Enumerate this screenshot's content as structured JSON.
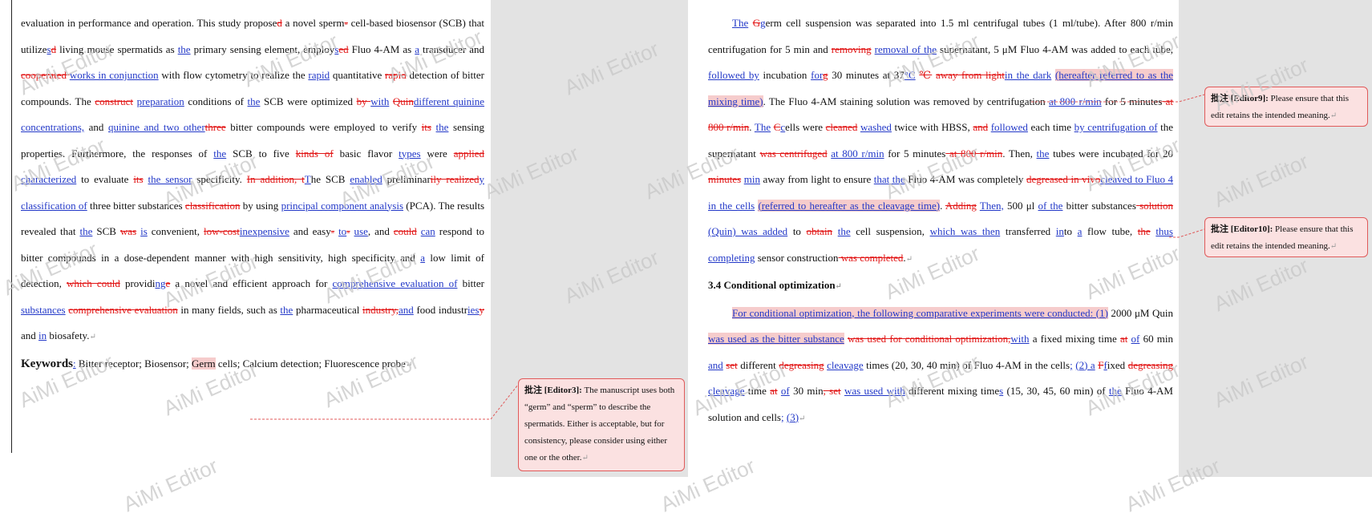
{
  "left_page": {
    "paragraphs": [
      {
        "segs": [
          {
            "t": "evaluation in performance and operation. This study propose"
          },
          {
            "t": "d",
            "s": "del"
          },
          {
            "t": " a novel sperm"
          },
          {
            "t": "-",
            "s": "del"
          },
          {
            "t": " cell-based biosensor (SCB) that utilize"
          },
          {
            "t": "s",
            "s": "ins"
          },
          {
            "t": "d",
            "s": "del"
          },
          {
            "t": " living mouse spermatids as "
          },
          {
            "t": "the",
            "s": "ins"
          },
          {
            "t": " primary sensing element, employ"
          },
          {
            "t": "s",
            "s": "ins"
          },
          {
            "t": "ed",
            "s": "del"
          },
          {
            "t": " Fluo 4-AM as "
          },
          {
            "t": "a",
            "s": "ins"
          },
          {
            "t": " transducer and "
          },
          {
            "t": "cooperated ",
            "s": "del"
          },
          {
            "t": "works in conjunction",
            "s": "ins"
          },
          {
            "t": " with flow cytometry to realize the "
          },
          {
            "t": "rapid",
            "s": "ins"
          },
          {
            "t": " quantitative "
          },
          {
            "t": "rapid",
            "s": "del"
          },
          {
            "t": " detection of bitter compounds. The "
          },
          {
            "t": "construct",
            "s": "del"
          },
          {
            "t": " "
          },
          {
            "t": "preparation",
            "s": "ins"
          },
          {
            "t": " conditions of "
          },
          {
            "t": "the",
            "s": "ins"
          },
          {
            "t": " SCB were optimized "
          },
          {
            "t": "by ",
            "s": "del"
          },
          {
            "t": "with",
            "s": "ins"
          },
          {
            "t": " "
          },
          {
            "t": "Quin",
            "s": "del"
          },
          {
            "t": "different quinine concentrations,",
            "s": "ins"
          },
          {
            "t": " and "
          },
          {
            "t": "quinine and two other",
            "s": "ins"
          },
          {
            "t": "three",
            "s": "del"
          },
          {
            "t": " bitter compounds were employed to verify "
          },
          {
            "t": "its",
            "s": "del"
          },
          {
            "t": " "
          },
          {
            "t": "the",
            "s": "ins"
          },
          {
            "t": " sensing properties. Furthermore, the responses of "
          },
          {
            "t": "the",
            "s": "ins"
          },
          {
            "t": " SCB to five "
          },
          {
            "t": "kinds of",
            "s": "del"
          },
          {
            "t": " basic flavor "
          },
          {
            "t": "types",
            "s": "ins"
          },
          {
            "t": " were "
          },
          {
            "t": "applied",
            "s": "del"
          },
          {
            "t": " "
          },
          {
            "t": "characterized",
            "s": "ins"
          },
          {
            "t": " to evaluate "
          },
          {
            "t": "its",
            "s": "del"
          },
          {
            "t": " "
          },
          {
            "t": "the sensor",
            "s": "ins"
          },
          {
            "t": " specificity. "
          },
          {
            "t": "In addition, t",
            "s": "del"
          },
          {
            "t": "T",
            "s": "ins"
          },
          {
            "t": "he SCB "
          },
          {
            "t": "enabled",
            "s": "ins"
          },
          {
            "t": " preliminar"
          },
          {
            "t": "ily realized",
            "s": "del"
          },
          {
            "t": "y",
            "s": "ins"
          },
          {
            "t": " "
          },
          {
            "t": "classification of",
            "s": "ins"
          },
          {
            "t": " three bitter substances "
          },
          {
            "t": "classification",
            "s": "del"
          },
          {
            "t": " by using "
          },
          {
            "t": "principal component analysis",
            "s": "ins"
          },
          {
            "t": " (PCA). The results revealed that "
          },
          {
            "t": "the",
            "s": "ins"
          },
          {
            "t": " SCB "
          },
          {
            "t": "was",
            "s": "del"
          },
          {
            "t": " "
          },
          {
            "t": "is",
            "s": "ins"
          },
          {
            "t": " convenient, "
          },
          {
            "t": "low-cost",
            "s": "del"
          },
          {
            "t": "inexpensive",
            "s": "ins"
          },
          {
            "t": " and easy"
          },
          {
            "t": "-",
            "s": "del"
          },
          {
            "t": " "
          },
          {
            "t": "to",
            "s": "ins"
          },
          {
            "t": "-",
            "s": "del"
          },
          {
            "t": " "
          },
          {
            "t": "use",
            "s": "ins"
          },
          {
            "t": ", and "
          },
          {
            "t": "could",
            "s": "del"
          },
          {
            "t": " "
          },
          {
            "t": "can",
            "s": "ins"
          },
          {
            "t": " respond to bitter compounds in a dose-dependent manner with high sensitivity, high specificity and "
          },
          {
            "t": "a",
            "s": "ins"
          },
          {
            "t": " low limit of detection, "
          },
          {
            "t": "which could",
            "s": "del"
          },
          {
            "t": " providi"
          },
          {
            "t": "ng",
            "s": "ins"
          },
          {
            "t": "e",
            "s": "del"
          },
          {
            "t": " a novel and efficient approach for "
          },
          {
            "t": "comprehensive evaluation of",
            "s": "ins"
          },
          {
            "t": " bitter "
          },
          {
            "t": "substances",
            "s": "ins"
          },
          {
            "t": " "
          },
          {
            "t": "comprehensive evaluation",
            "s": "del"
          },
          {
            "t": " in many fields, such as "
          },
          {
            "t": "the",
            "s": "ins"
          },
          {
            "t": " pharmaceutical "
          },
          {
            "t": "industry,",
            "s": "del"
          },
          {
            "t": "and",
            "s": "ins"
          },
          {
            "t": " food industr"
          },
          {
            "t": "ies",
            "s": "ins"
          },
          {
            "t": "y",
            "s": "del"
          },
          {
            "t": " and "
          },
          {
            "t": "in",
            "s": "ins"
          },
          {
            "t": " biosafety."
          }
        ]
      },
      {
        "keywords": true,
        "segs": [
          {
            "t": "Keywords",
            "s": "kwlabel"
          },
          {
            "t": ":",
            "s": "ins"
          },
          {
            "t": " Bitter receptor; Biosensor; "
          },
          {
            "t": "Germ",
            "s": "hl"
          },
          {
            "t": " cells; Calcium detection; Fluorescence probe"
          }
        ]
      }
    ]
  },
  "right_page": {
    "paragraphs": [
      {
        "indent": true,
        "segs": [
          {
            "t": "The",
            "s": "ins"
          },
          {
            "t": " "
          },
          {
            "t": "G",
            "s": "del"
          },
          {
            "t": "g",
            "s": "ins"
          },
          {
            "t": "erm cell suspension was separated into 1.5 ml centrifugal tubes (1 ml/tube). After 800 r/min centrifugation for 5 min and "
          },
          {
            "t": "removing",
            "s": "del"
          },
          {
            "t": " "
          },
          {
            "t": "removal of the",
            "s": "ins"
          },
          {
            "t": " supernatant, 5 μM Fluo 4-AM was added to each tube, "
          },
          {
            "t": "followed by",
            "s": "ins"
          },
          {
            "t": " incubation "
          },
          {
            "t": "for",
            "s": "ins"
          },
          {
            "t": "g",
            "s": "del"
          },
          {
            "t": " 30 minutes at 37"
          },
          {
            "t": "°C",
            "s": "ins"
          },
          {
            "t": " "
          },
          {
            "t": "℃",
            "s": "del"
          },
          {
            "t": " "
          },
          {
            "t": "away from light",
            "s": "del"
          },
          {
            "t": "in the dark",
            "s": "ins"
          },
          {
            "t": " "
          },
          {
            "t": "(hereafter referred to as the mixing time)",
            "s": "inshl"
          },
          {
            "t": ". The Fluo 4-AM staining solution was removed by centrifugation "
          },
          {
            "t": "at 800 r/min",
            "s": "ins"
          },
          {
            "t": " for 5 minutes"
          },
          {
            "t": " at 800 r/min",
            "s": "del"
          },
          {
            "t": ". "
          },
          {
            "t": "The",
            "s": "ins"
          },
          {
            "t": " "
          },
          {
            "t": "C",
            "s": "del"
          },
          {
            "t": "c",
            "s": "ins"
          },
          {
            "t": "ells were "
          },
          {
            "t": "cleaned",
            "s": "del"
          },
          {
            "t": " "
          },
          {
            "t": "washed",
            "s": "ins"
          },
          {
            "t": " twice with HBSS, "
          },
          {
            "t": "and",
            "s": "del"
          },
          {
            "t": " "
          },
          {
            "t": "followed",
            "s": "ins"
          },
          {
            "t": " each time "
          },
          {
            "t": "by centrifugation of",
            "s": "ins"
          },
          {
            "t": " the supernatant "
          },
          {
            "t": "was centrifuged",
            "s": "del"
          },
          {
            "t": " "
          },
          {
            "t": "at 800 r/min",
            "s": "ins"
          },
          {
            "t": " for 5 minutes"
          },
          {
            "t": " at 800 r/min",
            "s": "del"
          },
          {
            "t": ". Then, "
          },
          {
            "t": "the",
            "s": "ins"
          },
          {
            "t": " tubes were incubated for 20 "
          },
          {
            "t": "minutes",
            "s": "del"
          },
          {
            "t": " "
          },
          {
            "t": "min",
            "s": "ins"
          },
          {
            "t": " away from light to ensure "
          },
          {
            "t": "that the",
            "s": "ins"
          },
          {
            "t": " Fluo 4-AM was completely "
          },
          {
            "t": "degreased in vivo",
            "s": "del"
          },
          {
            "t": "cleaved to Fluo 4 in the cells",
            "s": "ins"
          },
          {
            "t": " "
          },
          {
            "t": "(referred to hereafter as the cleavage time)",
            "s": "inshl"
          },
          {
            "t": ". "
          },
          {
            "t": "Adding",
            "s": "del"
          },
          {
            "t": " "
          },
          {
            "t": "Then,",
            "s": "ins"
          },
          {
            "t": " 500 μl "
          },
          {
            "t": "of the",
            "s": "ins"
          },
          {
            "t": " bitter substances"
          },
          {
            "t": " solution",
            "s": "del"
          },
          {
            "t": " "
          },
          {
            "t": "(Quin) was added",
            "s": "ins"
          },
          {
            "t": " to "
          },
          {
            "t": "obtain",
            "s": "del"
          },
          {
            "t": " "
          },
          {
            "t": "the",
            "s": "ins"
          },
          {
            "t": " cell suspension, "
          },
          {
            "t": "which was then",
            "s": "ins"
          },
          {
            "t": " transferred "
          },
          {
            "t": "in",
            "s": "ins"
          },
          {
            "t": "to "
          },
          {
            "t": "a",
            "s": "ins"
          },
          {
            "t": " flow tube, "
          },
          {
            "t": "the",
            "s": "del"
          },
          {
            "t": " "
          },
          {
            "t": "thus completing",
            "s": "ins"
          },
          {
            "t": " sensor construction"
          },
          {
            "t": " was completed",
            "s": "del"
          },
          {
            "t": "."
          }
        ]
      },
      {
        "heading": true,
        "segs": [
          {
            "t": "3.4 Conditional optimization"
          }
        ]
      },
      {
        "indent": true,
        "segs": [
          {
            "t": "For conditional optimization, the following comparative experiments were conducted: (1)",
            "s": "inshl"
          },
          {
            "t": " 2000 μM Quin "
          },
          {
            "t": "was used as the bitter substance",
            "s": "inshl"
          },
          {
            "t": " "
          },
          {
            "t": "was used for conditional optimization,",
            "s": "del"
          },
          {
            "t": "with",
            "s": "ins"
          },
          {
            "t": " a fixed mixing time "
          },
          {
            "t": "at",
            "s": "del"
          },
          {
            "t": " "
          },
          {
            "t": "of",
            "s": "ins"
          },
          {
            "t": " 60 min"
          },
          {
            "t": " and",
            "s": "ins"
          },
          {
            "t": " "
          },
          {
            "t": "set",
            "s": "del"
          },
          {
            "t": " different "
          },
          {
            "t": "degreasing",
            "s": "del"
          },
          {
            "t": " "
          },
          {
            "t": "cleavage",
            "s": "ins"
          },
          {
            "t": " times (20, 30, 40 min) of Fluo 4-AM in the cells"
          },
          {
            "t": ";",
            "s": "ins"
          },
          {
            "t": " "
          },
          {
            "t": "(2) a",
            "s": "ins"
          },
          {
            "t": " "
          },
          {
            "t": "F",
            "s": "del"
          },
          {
            "t": "f",
            "s": "ins"
          },
          {
            "t": "ixed "
          },
          {
            "t": "degreasing",
            "s": "del"
          },
          {
            "t": " "
          },
          {
            "t": "cleavage",
            "s": "ins"
          },
          {
            "t": " time "
          },
          {
            "t": "at",
            "s": "del"
          },
          {
            "t": " "
          },
          {
            "t": "of",
            "s": "ins"
          },
          {
            "t": " 30 min"
          },
          {
            "t": ", set",
            "s": "del"
          },
          {
            "t": " "
          },
          {
            "t": "was used with",
            "s": "ins"
          },
          {
            "t": " different mixing time"
          },
          {
            "t": "s",
            "s": "ins"
          },
          {
            "t": " (15, 30, 45, 60 min) of "
          },
          {
            "t": "the",
            "s": "ins"
          },
          {
            "t": " Fluo 4-AM solution and cells"
          },
          {
            "t": ";",
            "s": "ins"
          },
          {
            "t": " "
          },
          {
            "t": "(3)",
            "s": "ins"
          }
        ]
      }
    ]
  },
  "comments": [
    {
      "header": "批注 [Editor3]:",
      "text": "The manuscript uses both “germ” and “sperm” to describe the spermatids. Either is acceptable, but for consistency, please consider using either one or the other."
    },
    {
      "header": "批注 [Editor9]:",
      "text": "Please ensure that this edit retains the intended meaning."
    },
    {
      "header": "批注 [Editor10]:",
      "text": "Please ensure that this edit retains the intended meaning."
    }
  ],
  "watermark": "AiMi Editor",
  "colors": {
    "insert": "#2238c8",
    "delete": "#e21818",
    "comment_bg": "#fbe1e1",
    "comment_border": "#e05a5a",
    "margin_bg": "#e3e3e3"
  }
}
